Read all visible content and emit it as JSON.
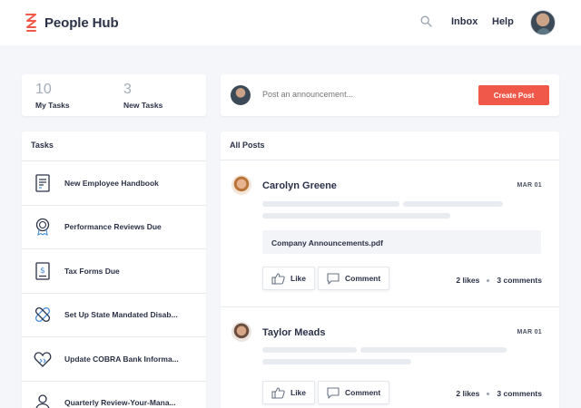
{
  "header": {
    "app_name": "People Hub",
    "logo_icon": "stacked-chevrons-logo",
    "brand_color": "#f0584a",
    "search_icon": "search-icon",
    "nav": {
      "inbox": "Inbox",
      "help": "Help"
    }
  },
  "stats": [
    {
      "value": "10",
      "label": "My Tasks"
    },
    {
      "value": "3",
      "label": "New Tasks"
    }
  ],
  "announcement": {
    "placeholder": "Post an announcement...",
    "button_label": "Create Post",
    "button_color": "#f0584a"
  },
  "tasks": {
    "title": "Tasks",
    "items": [
      {
        "label": "New Employee Handbook",
        "icon": "document-icon"
      },
      {
        "label": "Performance Reviews Due",
        "icon": "award-ribbon-icon"
      },
      {
        "label": "Tax Forms Due",
        "icon": "dollar-document-icon"
      },
      {
        "label": "Set Up State Mandated Disab...",
        "icon": "bandage-icon"
      },
      {
        "label": "Update COBRA Bank Informa...",
        "icon": "heart-hand-icon"
      },
      {
        "label": "Quarterly Review-Your-Mana...",
        "icon": "person-icon"
      }
    ]
  },
  "posts": {
    "title": "All Posts",
    "items": [
      {
        "author": "Carolyn Greene",
        "date": "MAR 01",
        "attachment": "Company Announcements.pdf",
        "like_label": "Like",
        "comment_label": "Comment",
        "likes": "2 likes",
        "comments": "3 comments"
      },
      {
        "author": "Taylor Meads",
        "date": "MAR 01",
        "like_label": "Like",
        "comment_label": "Comment",
        "likes": "2 likes",
        "comments": "3 comments"
      }
    ]
  }
}
